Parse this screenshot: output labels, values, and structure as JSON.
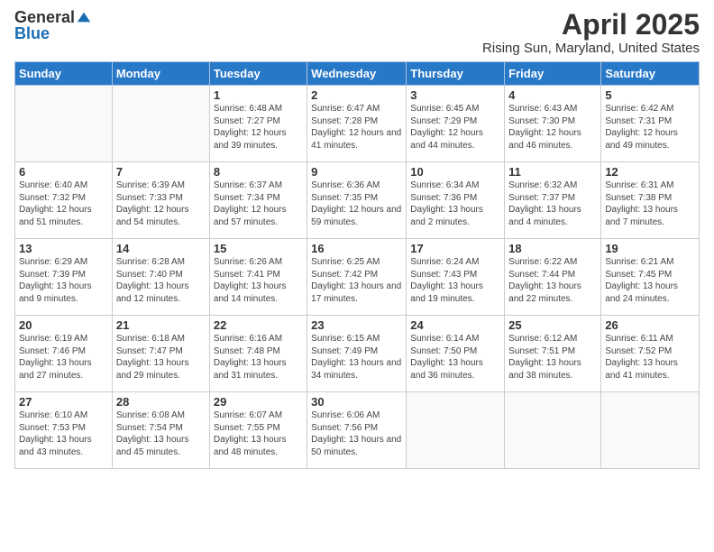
{
  "header": {
    "logo_general": "General",
    "logo_blue": "Blue",
    "month_title": "April 2025",
    "location": "Rising Sun, Maryland, United States"
  },
  "days_of_week": [
    "Sunday",
    "Monday",
    "Tuesday",
    "Wednesday",
    "Thursday",
    "Friday",
    "Saturday"
  ],
  "weeks": [
    [
      {
        "day": "",
        "info": ""
      },
      {
        "day": "",
        "info": ""
      },
      {
        "day": "1",
        "info": "Sunrise: 6:48 AM\nSunset: 7:27 PM\nDaylight: 12 hours and 39 minutes."
      },
      {
        "day": "2",
        "info": "Sunrise: 6:47 AM\nSunset: 7:28 PM\nDaylight: 12 hours and 41 minutes."
      },
      {
        "day": "3",
        "info": "Sunrise: 6:45 AM\nSunset: 7:29 PM\nDaylight: 12 hours and 44 minutes."
      },
      {
        "day": "4",
        "info": "Sunrise: 6:43 AM\nSunset: 7:30 PM\nDaylight: 12 hours and 46 minutes."
      },
      {
        "day": "5",
        "info": "Sunrise: 6:42 AM\nSunset: 7:31 PM\nDaylight: 12 hours and 49 minutes."
      }
    ],
    [
      {
        "day": "6",
        "info": "Sunrise: 6:40 AM\nSunset: 7:32 PM\nDaylight: 12 hours and 51 minutes."
      },
      {
        "day": "7",
        "info": "Sunrise: 6:39 AM\nSunset: 7:33 PM\nDaylight: 12 hours and 54 minutes."
      },
      {
        "day": "8",
        "info": "Sunrise: 6:37 AM\nSunset: 7:34 PM\nDaylight: 12 hours and 57 minutes."
      },
      {
        "day": "9",
        "info": "Sunrise: 6:36 AM\nSunset: 7:35 PM\nDaylight: 12 hours and 59 minutes."
      },
      {
        "day": "10",
        "info": "Sunrise: 6:34 AM\nSunset: 7:36 PM\nDaylight: 13 hours and 2 minutes."
      },
      {
        "day": "11",
        "info": "Sunrise: 6:32 AM\nSunset: 7:37 PM\nDaylight: 13 hours and 4 minutes."
      },
      {
        "day": "12",
        "info": "Sunrise: 6:31 AM\nSunset: 7:38 PM\nDaylight: 13 hours and 7 minutes."
      }
    ],
    [
      {
        "day": "13",
        "info": "Sunrise: 6:29 AM\nSunset: 7:39 PM\nDaylight: 13 hours and 9 minutes."
      },
      {
        "day": "14",
        "info": "Sunrise: 6:28 AM\nSunset: 7:40 PM\nDaylight: 13 hours and 12 minutes."
      },
      {
        "day": "15",
        "info": "Sunrise: 6:26 AM\nSunset: 7:41 PM\nDaylight: 13 hours and 14 minutes."
      },
      {
        "day": "16",
        "info": "Sunrise: 6:25 AM\nSunset: 7:42 PM\nDaylight: 13 hours and 17 minutes."
      },
      {
        "day": "17",
        "info": "Sunrise: 6:24 AM\nSunset: 7:43 PM\nDaylight: 13 hours and 19 minutes."
      },
      {
        "day": "18",
        "info": "Sunrise: 6:22 AM\nSunset: 7:44 PM\nDaylight: 13 hours and 22 minutes."
      },
      {
        "day": "19",
        "info": "Sunrise: 6:21 AM\nSunset: 7:45 PM\nDaylight: 13 hours and 24 minutes."
      }
    ],
    [
      {
        "day": "20",
        "info": "Sunrise: 6:19 AM\nSunset: 7:46 PM\nDaylight: 13 hours and 27 minutes."
      },
      {
        "day": "21",
        "info": "Sunrise: 6:18 AM\nSunset: 7:47 PM\nDaylight: 13 hours and 29 minutes."
      },
      {
        "day": "22",
        "info": "Sunrise: 6:16 AM\nSunset: 7:48 PM\nDaylight: 13 hours and 31 minutes."
      },
      {
        "day": "23",
        "info": "Sunrise: 6:15 AM\nSunset: 7:49 PM\nDaylight: 13 hours and 34 minutes."
      },
      {
        "day": "24",
        "info": "Sunrise: 6:14 AM\nSunset: 7:50 PM\nDaylight: 13 hours and 36 minutes."
      },
      {
        "day": "25",
        "info": "Sunrise: 6:12 AM\nSunset: 7:51 PM\nDaylight: 13 hours and 38 minutes."
      },
      {
        "day": "26",
        "info": "Sunrise: 6:11 AM\nSunset: 7:52 PM\nDaylight: 13 hours and 41 minutes."
      }
    ],
    [
      {
        "day": "27",
        "info": "Sunrise: 6:10 AM\nSunset: 7:53 PM\nDaylight: 13 hours and 43 minutes."
      },
      {
        "day": "28",
        "info": "Sunrise: 6:08 AM\nSunset: 7:54 PM\nDaylight: 13 hours and 45 minutes."
      },
      {
        "day": "29",
        "info": "Sunrise: 6:07 AM\nSunset: 7:55 PM\nDaylight: 13 hours and 48 minutes."
      },
      {
        "day": "30",
        "info": "Sunrise: 6:06 AM\nSunset: 7:56 PM\nDaylight: 13 hours and 50 minutes."
      },
      {
        "day": "",
        "info": ""
      },
      {
        "day": "",
        "info": ""
      },
      {
        "day": "",
        "info": ""
      }
    ]
  ]
}
